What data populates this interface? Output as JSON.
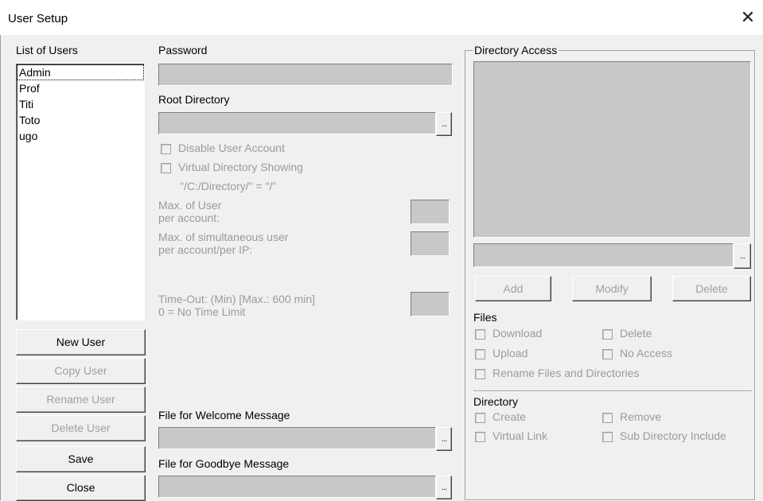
{
  "window": {
    "title": "User Setup",
    "close_symbol": "✕"
  },
  "users": {
    "label": "List of Users",
    "items": [
      "Admin",
      "Prof",
      "Titi",
      "Toto",
      "ugo"
    ],
    "selected": "Admin"
  },
  "user_buttons": {
    "new": "New User",
    "copy": "Copy User",
    "rename": "Rename User",
    "delete": "Delete User",
    "save": "Save",
    "close": "Close"
  },
  "password": {
    "label": "Password",
    "value": ""
  },
  "root_directory": {
    "label": "Root Directory",
    "value": "",
    "browse": "..."
  },
  "account_options": {
    "disable_account": "Disable User Account",
    "virtual_directory_showing": "Virtual Directory Showing",
    "virtual_directory_example": "\"/C:/Directory/\" = \"/\"",
    "max_user_line1": "Max. of User",
    "max_user_line2": "per account:",
    "max_simultaneous_line1": "Max. of simultaneous user",
    "max_simultaneous_line2": "per account/per IP:",
    "timeout_line1": "Time-Out: (Min) [Max.: 600 min]",
    "timeout_line2": "0 = No Time Limit"
  },
  "welcome_message": {
    "label": "File for Welcome Message",
    "value": "",
    "browse": "..."
  },
  "goodbye_message": {
    "label": "File for Goodbye Message",
    "value": "",
    "browse": "..."
  },
  "directory_access": {
    "title": "Directory Access",
    "path_value": "",
    "browse": "...",
    "add": "Add",
    "modify": "Modify",
    "delete": "Delete",
    "files_label": "Files",
    "files": {
      "download": "Download",
      "delete": "Delete",
      "upload": "Upload",
      "no_access": "No Access",
      "rename": "Rename Files and Directories"
    },
    "directory_label": "Directory",
    "directory": {
      "create": "Create",
      "remove": "Remove",
      "virtual_link": "Virtual Link",
      "sub_directory_include": "Sub Directory Include"
    }
  }
}
